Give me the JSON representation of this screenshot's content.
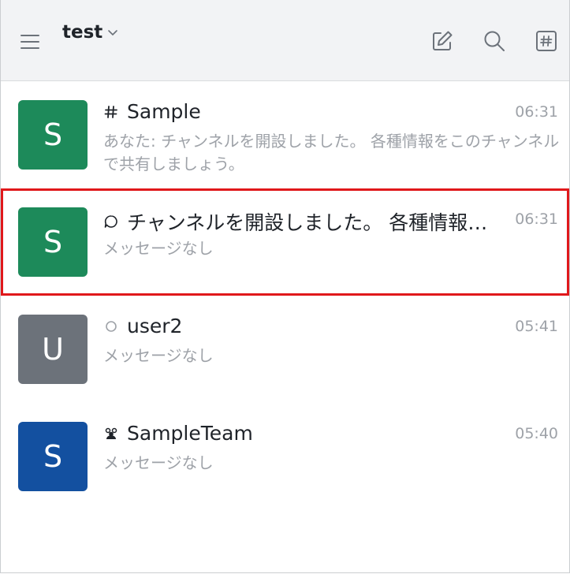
{
  "header": {
    "workspace_name": "test",
    "icons": [
      "menu-icon",
      "chevron-down-icon",
      "edit-icon",
      "search-icon",
      "directory-icon"
    ]
  },
  "rooms": [
    {
      "avatar_letter": "S",
      "avatar_color": "#1d8a5a",
      "type_icon": "hashtag-icon",
      "name": "Sample",
      "time": "06:31",
      "preview": "あなた: チャンネルを開設しました。 各種情報をこのチャンネルで共有しましょう。"
    },
    {
      "avatar_letter": "S",
      "avatar_color": "#1d8a5a",
      "type_icon": "discussion-icon",
      "name": "チャンネルを開設しました。 各種情報をこのチャンネルで共有しましょう。",
      "time": "06:31",
      "preview": "メッセージなし",
      "selected": true
    },
    {
      "avatar_letter": "U",
      "avatar_color": "#6c727a",
      "type_icon": "status-offline-icon",
      "name": "user2",
      "time": "05:41",
      "preview": "メッセージなし"
    },
    {
      "avatar_letter": "S",
      "avatar_color": "#1350a0",
      "type_icon": "team-icon",
      "name": "SampleTeam",
      "time": "05:40",
      "preview": "メッセージなし"
    }
  ],
  "colors": {
    "header_bg": "#f2f3f5",
    "secondary_text": "#9ea2a8",
    "selection_outline": "#e0181b"
  }
}
